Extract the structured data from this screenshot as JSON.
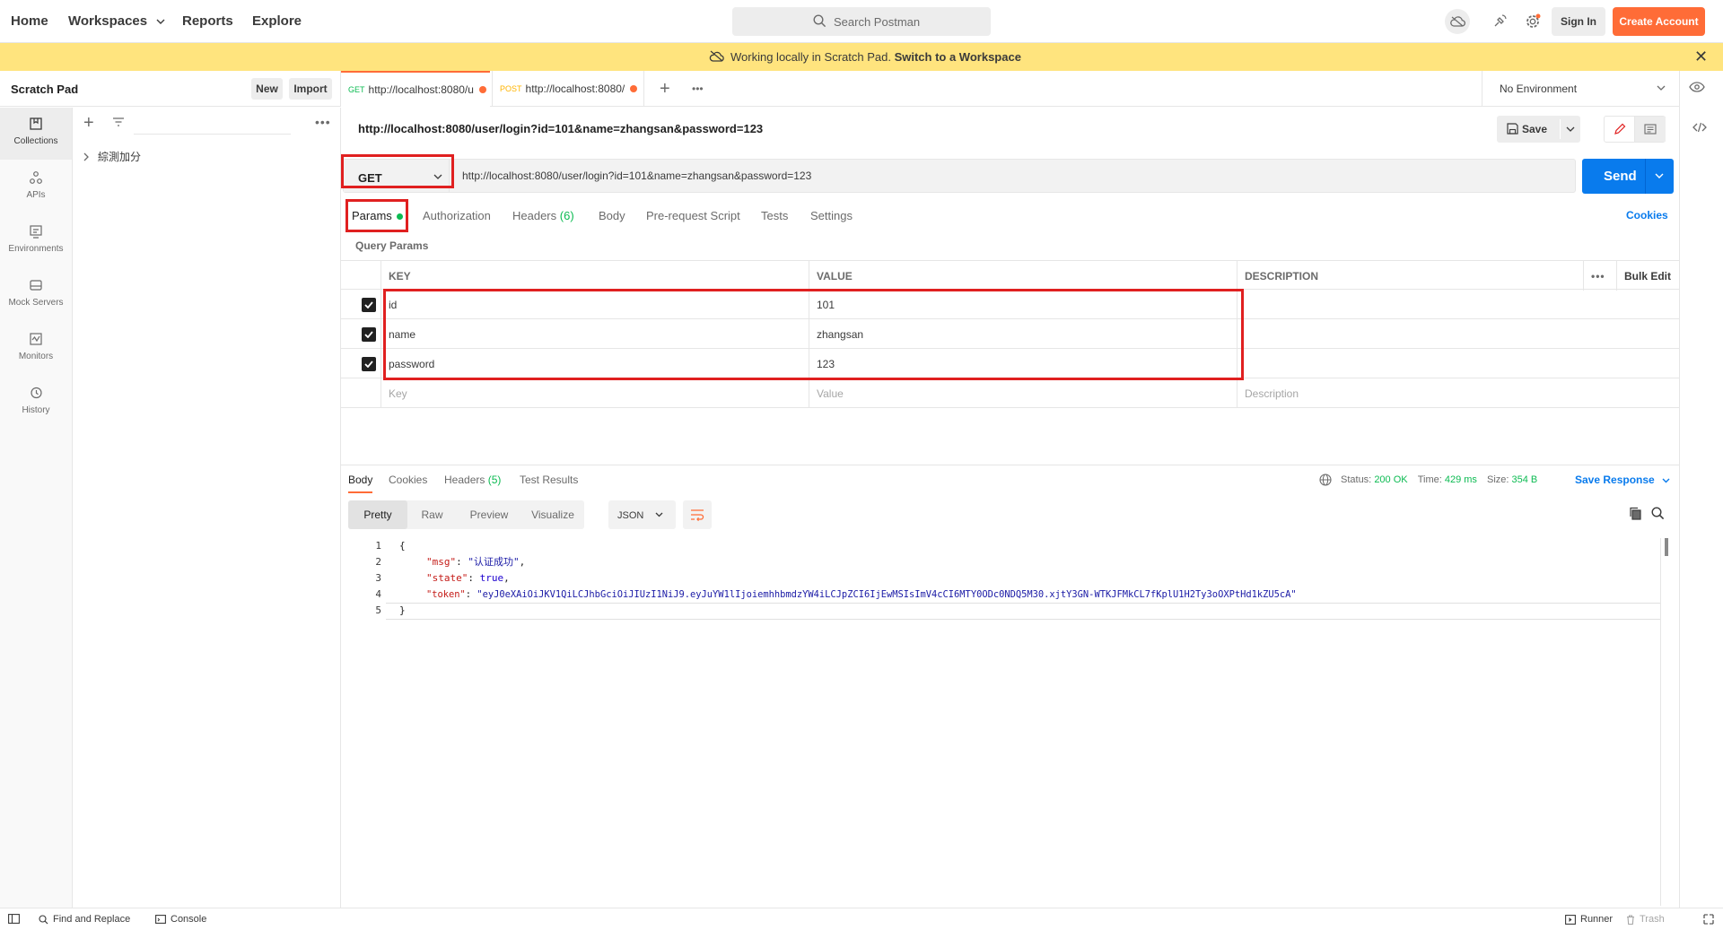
{
  "topbar": {
    "nav": [
      "Home",
      "Workspaces",
      "Reports",
      "Explore"
    ],
    "search_placeholder": "Search Postman",
    "sign_in": "Sign In",
    "create_account": "Create Account"
  },
  "banner": {
    "text": "Working locally in Scratch Pad.",
    "link": "Switch to a Workspace"
  },
  "sidebar": {
    "title": "Scratch Pad",
    "new_label": "New",
    "import_label": "Import",
    "items": [
      {
        "label": "Collections",
        "icon": "collections-icon"
      },
      {
        "label": "APIs",
        "icon": "apis-icon"
      },
      {
        "label": "Environments",
        "icon": "environments-icon"
      },
      {
        "label": "Mock Servers",
        "icon": "mock-servers-icon"
      },
      {
        "label": "Monitors",
        "icon": "monitors-icon"
      },
      {
        "label": "History",
        "icon": "history-icon"
      }
    ],
    "collection": "綜測加分"
  },
  "tabs": [
    {
      "method": "GET",
      "label": "http://localhost:8080/u"
    },
    {
      "method": "POST",
      "label": "http://localhost:8080/"
    }
  ],
  "environment": "No Environment",
  "request": {
    "name": "http://localhost:8080/user/login?id=101&name=zhangsan&password=123",
    "save_label": "Save",
    "method": "GET",
    "url": "http://localhost:8080/user/login?id=101&name=zhangsan&password=123",
    "send_label": "Send",
    "tabs": [
      {
        "label": "Params"
      },
      {
        "label": "Authorization"
      },
      {
        "label": "Headers",
        "count": "(6)"
      },
      {
        "label": "Body"
      },
      {
        "label": "Pre-request Script"
      },
      {
        "label": "Tests"
      },
      {
        "label": "Settings"
      }
    ],
    "cookies_label": "Cookies",
    "query_params_label": "Query Params",
    "table": {
      "headers": [
        "KEY",
        "VALUE",
        "DESCRIPTION"
      ],
      "bulk_edit": "Bulk Edit",
      "rows": [
        {
          "key": "id",
          "value": "101",
          "description": ""
        },
        {
          "key": "name",
          "value": "zhangsan",
          "description": ""
        },
        {
          "key": "password",
          "value": "123",
          "description": ""
        }
      ],
      "placeholders": {
        "key": "Key",
        "value": "Value",
        "description": "Description"
      }
    }
  },
  "response": {
    "tabs": [
      {
        "label": "Body"
      },
      {
        "label": "Cookies"
      },
      {
        "label": "Headers",
        "count": "(5)"
      },
      {
        "label": "Test Results"
      }
    ],
    "status_label": "Status:",
    "status": "200 OK",
    "time_label": "Time:",
    "time": "429 ms",
    "size_label": "Size:",
    "size": "354 B",
    "save_response": "Save Response",
    "formats": [
      "Pretty",
      "Raw",
      "Preview",
      "Visualize"
    ],
    "language": "JSON",
    "code": {
      "line_numbers": [
        "1",
        "2",
        "3",
        "4",
        "5"
      ],
      "open": "{",
      "close": "}",
      "msg_key": "\"msg\"",
      "msg_val": "\"认证成功\"",
      "state_key": "\"state\"",
      "state_val": "true",
      "token_key": "\"token\"",
      "token_val": "\"eyJ0eXAiOiJKV1QiLCJhbGciOiJIUzI1NiJ9.eyJuYW1lIjoiemhhbmdzYW4iLCJpZCI6IjEwMSIsImV4cCI6MTY0ODc0NDQ5M30.xjtY3GN-WTKJFMkCL7fKplU1H2Ty3oOXPtHd1kZU5cA\""
    }
  },
  "footer": {
    "find_replace": "Find and Replace",
    "console": "Console",
    "runner": "Runner",
    "trash": "Trash"
  },
  "colors": {
    "accent": "#ff6c37",
    "primary": "#097bed",
    "banner": "#ffe47e",
    "success": "#0cbb52",
    "highlight": "#e02020"
  }
}
